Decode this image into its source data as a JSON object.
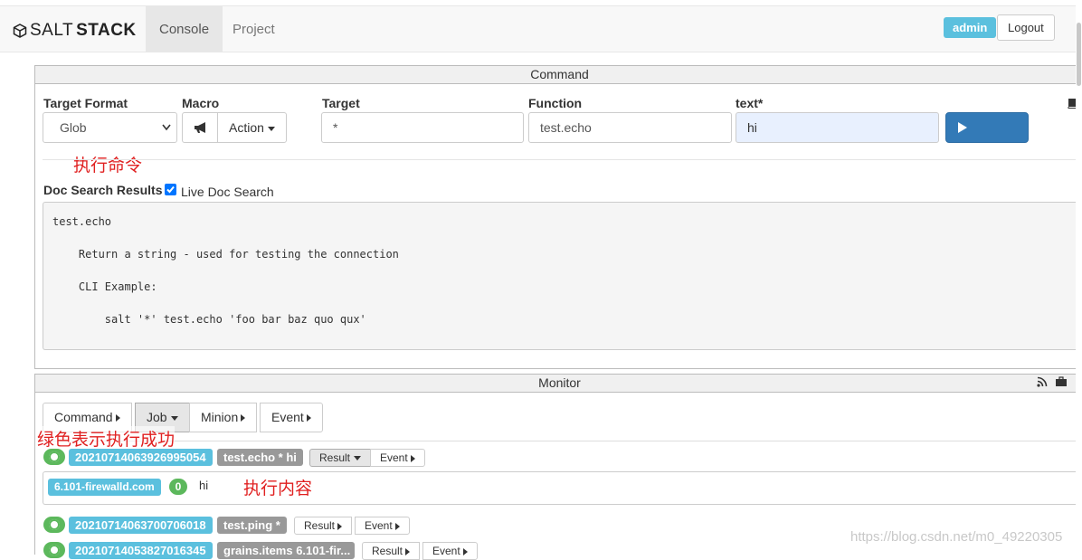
{
  "brand": {
    "part1": "SALT",
    "part2": "STACK"
  },
  "nav": {
    "console": "Console",
    "project": "Project"
  },
  "user": {
    "name": "admin",
    "logout": "Logout"
  },
  "command": {
    "title": "Command",
    "target_format_label": "Target Format",
    "target_format_value": "Glob",
    "macro_label": "Macro",
    "action_label": "Action",
    "target_label": "Target",
    "target_value": "*",
    "function_label": "Function",
    "function_value": "test.echo",
    "text_label": "text*",
    "text_value": "hi",
    "execute_label": "Execute",
    "doc_results_label": "Doc Search Results",
    "live_doc_label": "Live Doc Search",
    "live_doc_checked": true,
    "doc_text": "test.echo\n\n    Return a string - used for testing the connection\n\n    CLI Example:\n\n        salt '*' test.echo 'foo bar baz quo qux'"
  },
  "annotations": {
    "exec_cmd": "执行命令",
    "green_success": "绿色表示执行成功",
    "exec_content": "执行内容"
  },
  "monitor": {
    "title": "Monitor",
    "tabs": [
      {
        "label": "Command",
        "caret": "right"
      },
      {
        "label": "Job",
        "caret": "down"
      },
      {
        "label": "Minion",
        "caret": "right"
      },
      {
        "label": "Event",
        "caret": "right"
      }
    ],
    "jobs": [
      {
        "jid": "20210714063926995054",
        "cmd": "test.echo * hi",
        "result": "Result",
        "event": "Event",
        "minion": "6.101-firewalld.com",
        "retcode": "0",
        "output": "hi"
      },
      {
        "jid": "20210714063700706018",
        "cmd": "test.ping *",
        "result": "Result",
        "event": "Event"
      },
      {
        "jid": "20210714053827016345",
        "cmd": "grains.items 6.101-fir...",
        "result": "Result",
        "event": "Event"
      }
    ]
  },
  "watermark": "https://blog.csdn.net/m0_49220305"
}
